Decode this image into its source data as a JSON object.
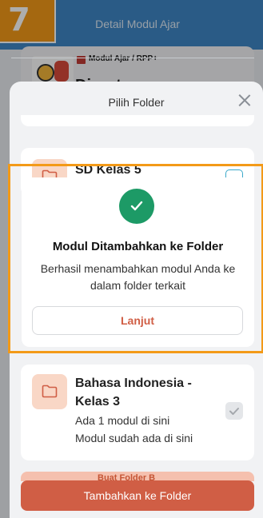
{
  "step_badge": "7",
  "appbar": {
    "title": "Detail Modul Ajar"
  },
  "module": {
    "tag": "Modul Ajar / RPP+",
    "name_partial": "Dirgat"
  },
  "sheet": {
    "title": "Pilih Folder",
    "folders": [
      {
        "name": "SD Kelas 5",
        "checked": false
      },
      {
        "name": "Bahasa Indonesia - Kelas 3",
        "count_text": "Ada 1 modul di sini",
        "note": "Modul sudah ada di sini",
        "checked": true
      }
    ],
    "create_label": "Buat Folder B",
    "submit_label": "Tambahkan ke Folder"
  },
  "dialog": {
    "title": "Modul Ditambahkan ke Folder",
    "message": "Berhasil menambahkan modul Anda ke dalam folder terkait",
    "button_label": "Lanjut"
  },
  "colors": {
    "primary": "#3e86c6",
    "accent": "#d05e45",
    "success": "#1d9a66",
    "highlight": "#f39a18"
  }
}
